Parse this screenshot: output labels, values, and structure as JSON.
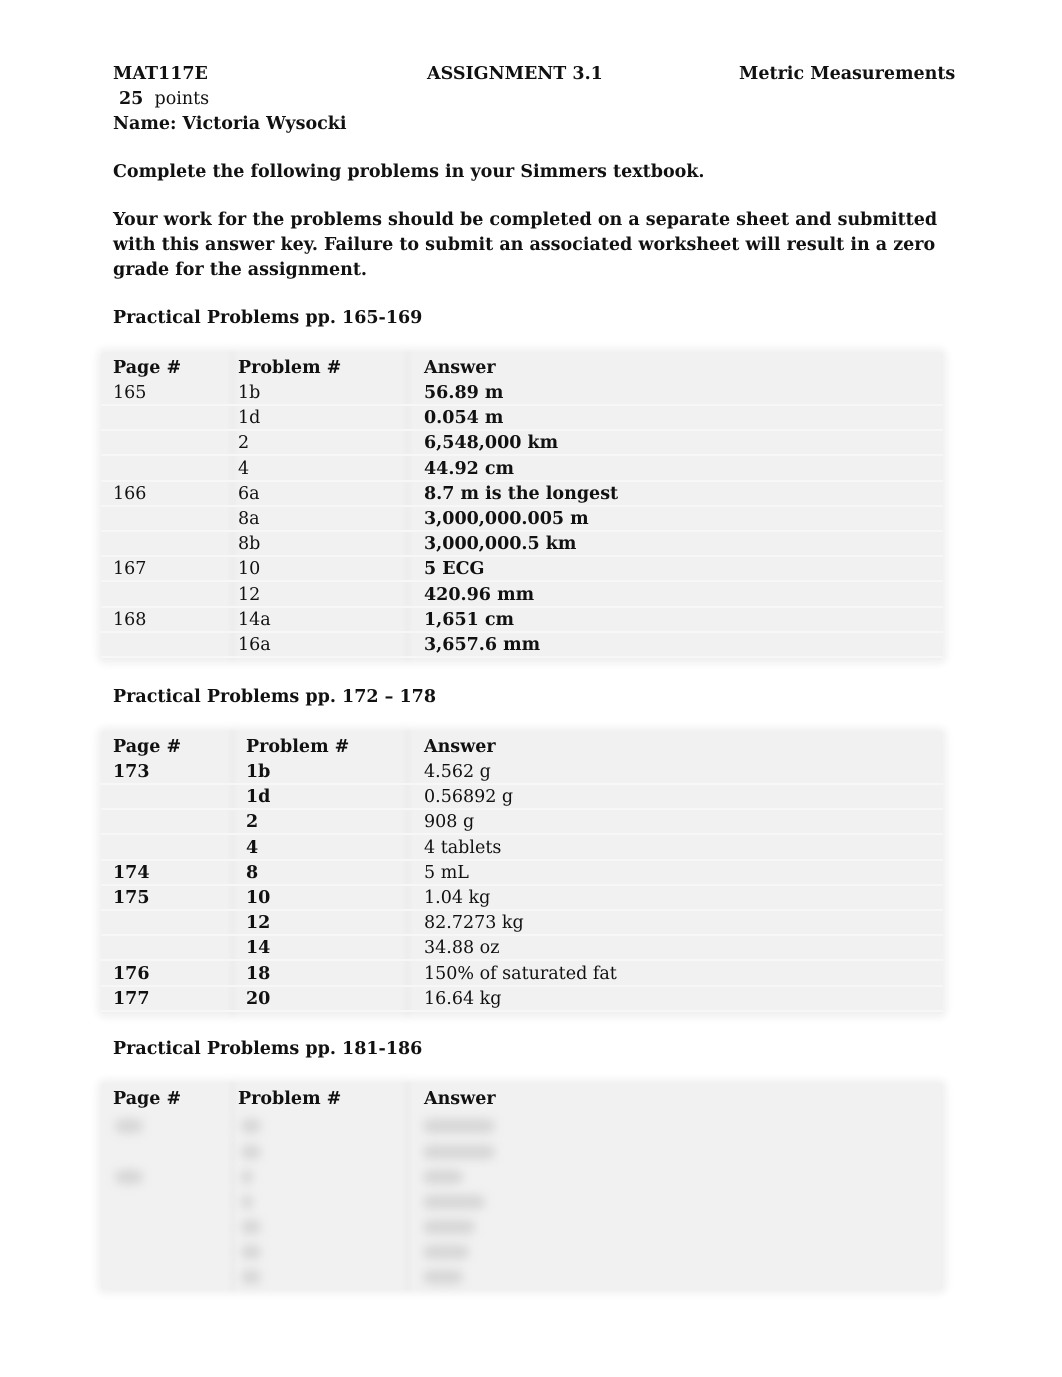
{
  "header": {
    "course": "MAT117E",
    "assignment": "ASSIGNMENT 3.1",
    "topic": "Metric Measurements",
    "points_value": "25",
    "points_label": "points",
    "name_line": "Name: Victoria Wysocki"
  },
  "instructions": {
    "line1": "Complete the following problems in your Simmers textbook.",
    "para2_line1": "Your work for the problems should be completed on a separate sheet and submitted",
    "para2_line2": "with this answer key.  Failure to submit an associated worksheet will result in a zero",
    "para2_line3": "grade for the assignment."
  },
  "sections": [
    {
      "title": "Practical Problems pp. 165-169",
      "columns": [
        "Page #",
        "Problem #",
        "Answer"
      ],
      "rows": [
        {
          "page": "165",
          "problem": "1b",
          "answer": "56.89 m"
        },
        {
          "page": "",
          "problem": "1d",
          "answer": "0.054 m"
        },
        {
          "page": "",
          "problem": "2",
          "answer": "6,548,000 km"
        },
        {
          "page": "",
          "problem": "4",
          "answer": "44.92 cm"
        },
        {
          "page": "166",
          "problem": "6a",
          "answer": "8.7 m is the longest"
        },
        {
          "page": "",
          "problem": "8a",
          "answer": "3,000,000.005 m"
        },
        {
          "page": "",
          "problem": "8b",
          "answer": "3,000,000.5 km"
        },
        {
          "page": "167",
          "problem": "10",
          "answer": "5 ECG"
        },
        {
          "page": "",
          "problem": "12",
          "answer": "420.96 mm"
        },
        {
          "page": "168",
          "problem": "14a",
          "answer": "1,651 cm"
        },
        {
          "page": "",
          "problem": "16a",
          "answer": "3,657.6 mm"
        }
      ]
    },
    {
      "title": "Practical Problems pp. 172 – 178",
      "columns": [
        "Page #",
        "Problem #",
        "Answer"
      ],
      "rows": [
        {
          "page": "173",
          "problem": "1b",
          "answer": "4.562 g"
        },
        {
          "page": "",
          "problem": "1d",
          "answer": "0.56892 g"
        },
        {
          "page": "",
          "problem": "2",
          "answer": "908 g"
        },
        {
          "page": "",
          "problem": "4",
          "answer": "4 tablets"
        },
        {
          "page": "174",
          "problem": "8",
          "answer": "5 mL"
        },
        {
          "page": "175",
          "problem": "10",
          "answer": "1.04 kg"
        },
        {
          "page": "",
          "problem": "12",
          "answer": "82.7273 kg"
        },
        {
          "page": "",
          "problem": "14",
          "answer": "34.88 oz"
        },
        {
          "page": "176",
          "problem": "18",
          "answer": "150% of saturated fat"
        },
        {
          "page": "177",
          "problem": "20",
          "answer": "16.64 kg"
        }
      ]
    },
    {
      "title": "Practical Problems pp. 181-186",
      "columns": [
        "Page #",
        "Problem #",
        "Answer"
      ],
      "rows_note": "rows blurred / illegible"
    }
  ]
}
